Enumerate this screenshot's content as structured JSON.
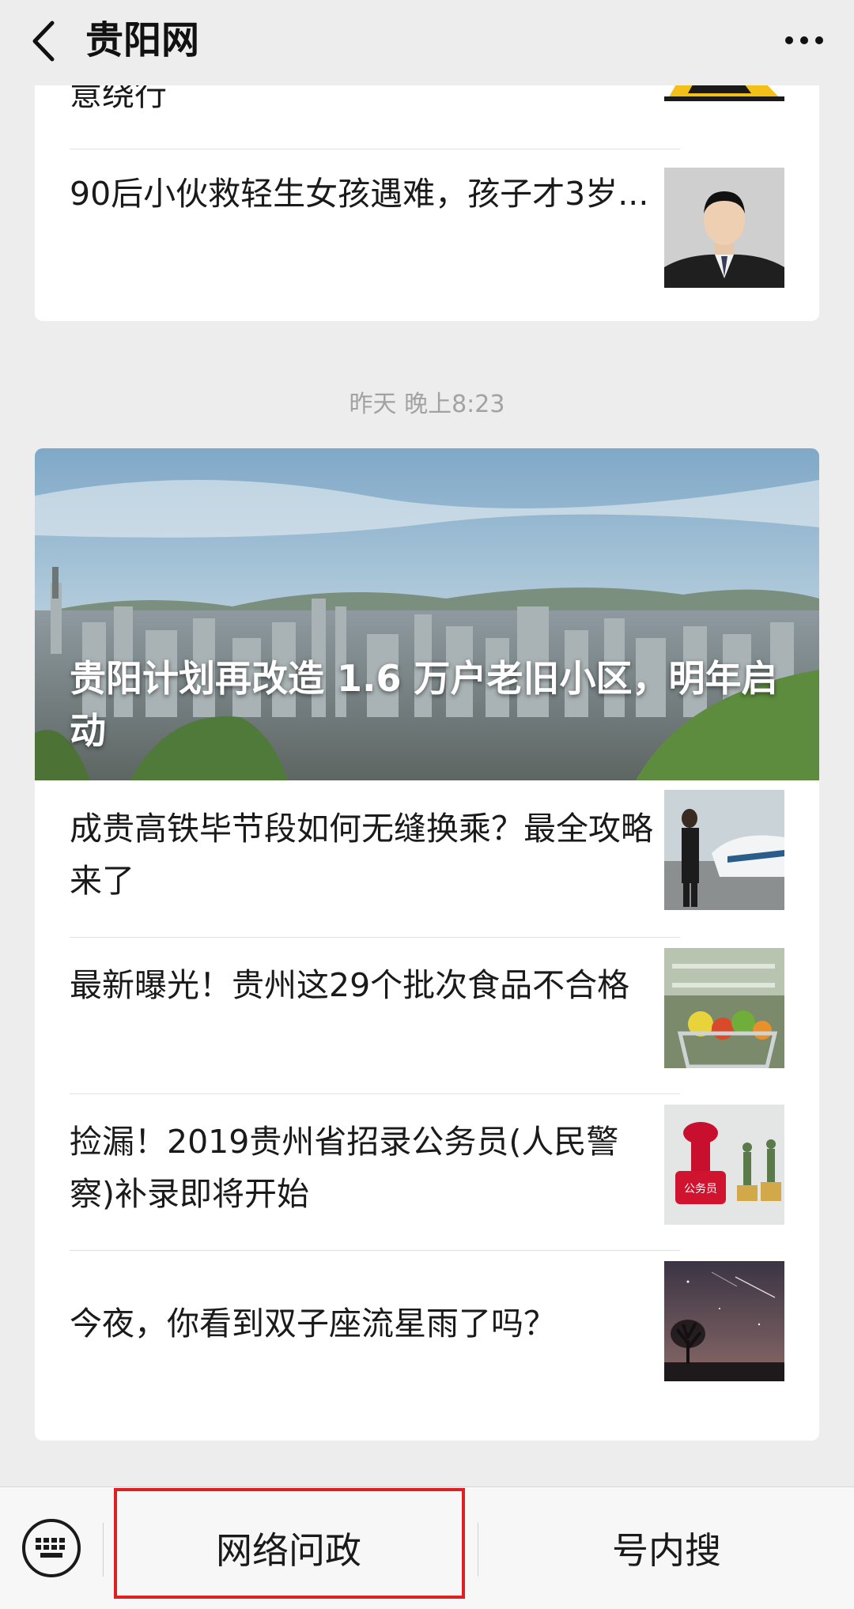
{
  "header": {
    "title": "贵阳网"
  },
  "top_card": {
    "items": [
      {
        "text": "意绕行"
      },
      {
        "text": "90后小伙救轻生女孩遇难，孩子才3岁..."
      }
    ]
  },
  "timestamp": "昨天 晚上8:23",
  "main_card": {
    "hero_title": "贵阳计划再改造 1.6 万户老旧小区，明年启动",
    "items": [
      {
        "text": "成贵高铁毕节段如何无缝换乘？最全攻略来了"
      },
      {
        "text": "最新曝光！贵州这29个批次食品不合格"
      },
      {
        "text": "捡漏！2019贵州省招录公务员(人民警察)补录即将开始"
      },
      {
        "text": "今夜，你看到双子座流星雨了吗？"
      }
    ],
    "thumb_labels": {
      "stamp": "公务员"
    }
  },
  "bottom_menu": {
    "items": [
      {
        "label": "网络问政"
      },
      {
        "label": "号内搜"
      }
    ]
  },
  "colors": {
    "background": "#ededed",
    "highlight": "#e02020"
  }
}
